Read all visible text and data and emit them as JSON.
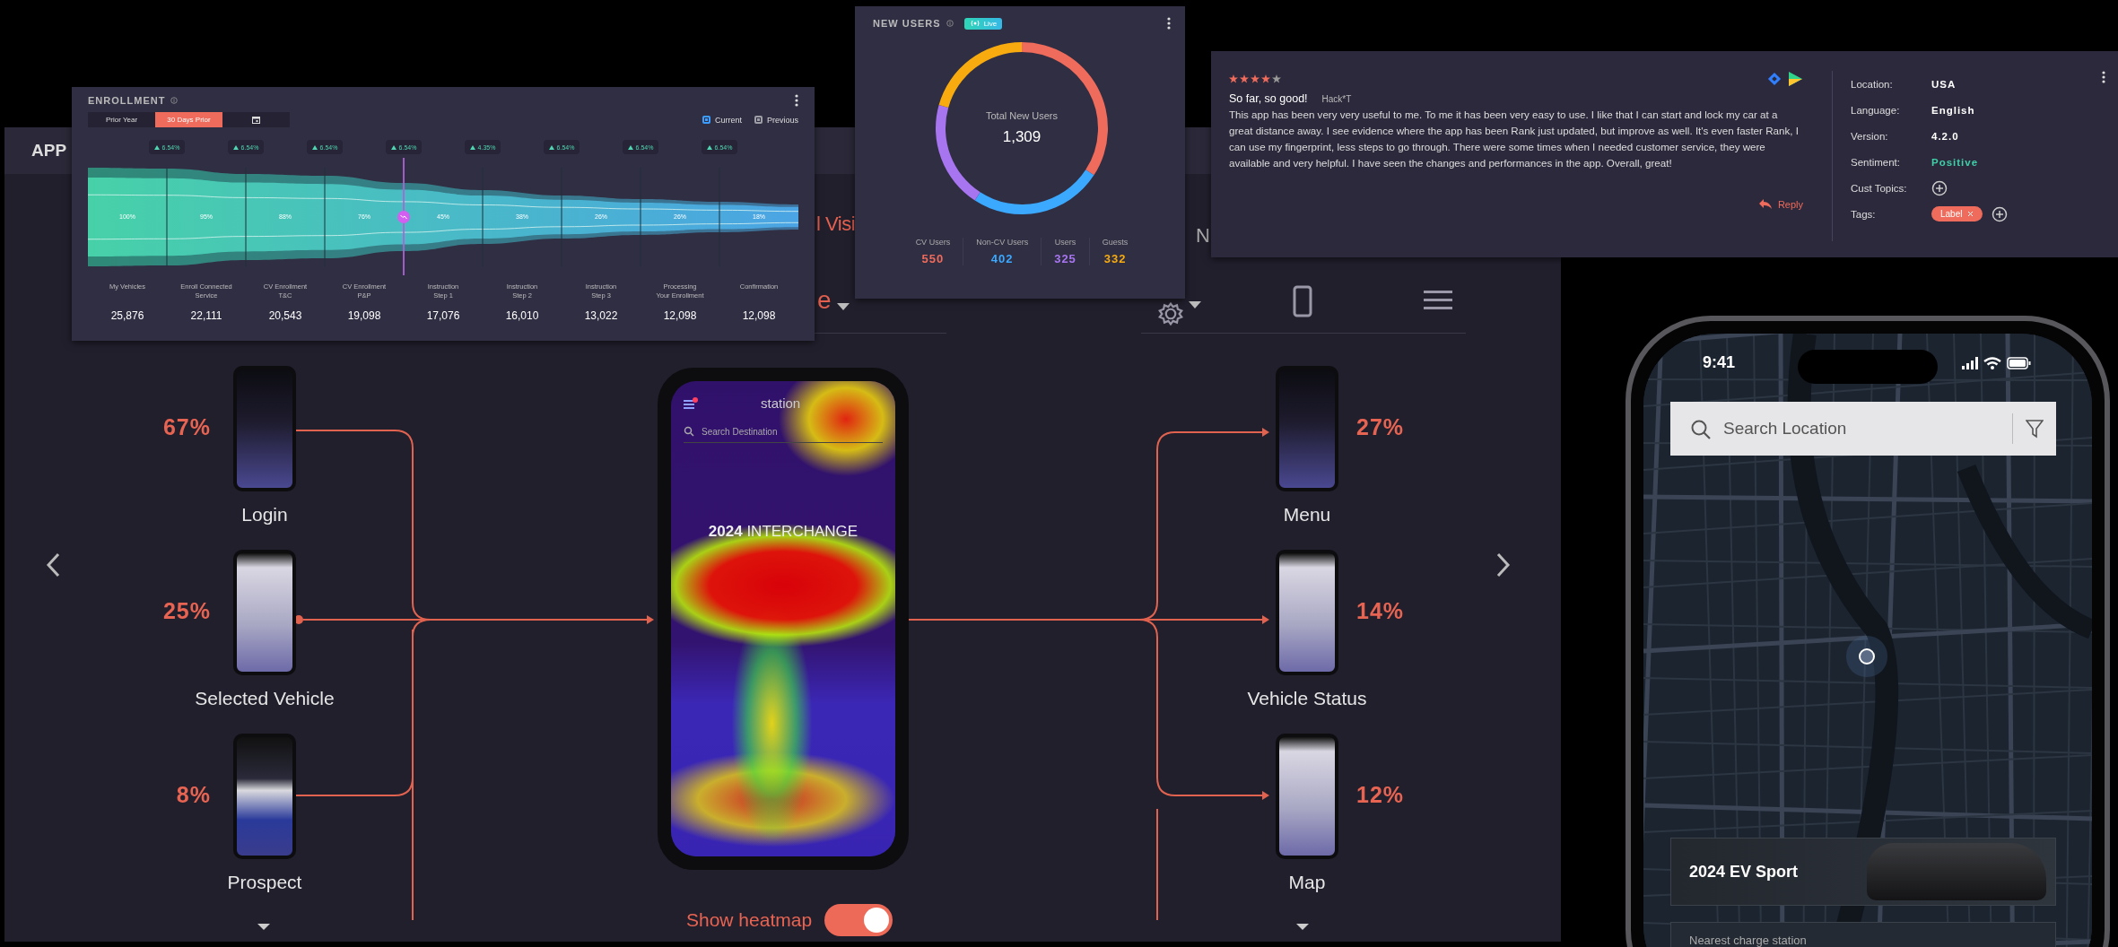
{
  "app_panel": {
    "title": "APP",
    "heading_fragment": "l Visi",
    "dropdown_fragment": "e",
    "side_fragment": "N"
  },
  "flow": {
    "sources": [
      {
        "percent": "67%",
        "label": "Login"
      },
      {
        "percent": "25%",
        "label": "Selected Vehicle"
      },
      {
        "percent": "8%",
        "label": "Prospect"
      }
    ],
    "targets": [
      {
        "percent": "27%",
        "label": "Menu"
      },
      {
        "percent": "14%",
        "label": "Vehicle Status"
      },
      {
        "percent": "12%",
        "label": "Map"
      }
    ]
  },
  "heatmap_phone": {
    "app_name": "station",
    "search_placeholder": "Search Destination",
    "headline": "**2024** INTERCHANGE"
  },
  "show_heatmap": {
    "label": "Show heatmap",
    "on": true
  },
  "enrollment": {
    "title": "ENROLLMENT",
    "periods": [
      {
        "label": "Prior Year",
        "selected": false
      },
      {
        "label": "30 Days Prior",
        "selected": true
      }
    ],
    "legend": [
      {
        "label": "Current",
        "checked": true,
        "color": "#3b9dff"
      },
      {
        "label": "Previous",
        "checked": true,
        "color": "#9e9ea6"
      }
    ],
    "changes": [
      "6.54%",
      "6.54%",
      "6.54%",
      "6.54%",
      "4.35%",
      "6.54%",
      "6.54%",
      "6.54%"
    ],
    "stages": [
      {
        "percent": "100%",
        "name": "My Vehicles",
        "count": "25,876"
      },
      {
        "percent": "95%",
        "name": "Enroll Connected\nService",
        "count": "22,111"
      },
      {
        "percent": "88%",
        "name": "CV Enrollment\nT&C",
        "count": "20,543"
      },
      {
        "percent": "76%",
        "name": "CV Enrollment\nP&P",
        "count": "19,098"
      },
      {
        "percent": "45%",
        "name": "Instruction\nStep 1",
        "count": "17,076"
      },
      {
        "percent": "38%",
        "name": "Instruction\nStep 2",
        "count": "16,010"
      },
      {
        "percent": "26%",
        "name": "Instruction\nStep 3",
        "count": "13,022"
      },
      {
        "percent": "26%",
        "name": "Processing\nYour Enrollment",
        "count": "12,098"
      },
      {
        "percent": "18%",
        "name": "Confirmation",
        "count": "12,098"
      }
    ]
  },
  "new_users": {
    "title": "NEW USERS",
    "badge": "Live",
    "center_label": "Total New Users",
    "total": "1,309",
    "legend": [
      {
        "label": "CV Users",
        "value": "550",
        "color": "#ef6b5b"
      },
      {
        "label": "Non-CV Users",
        "value": "402",
        "color": "#3ba9ff"
      },
      {
        "label": "Users",
        "value": "325",
        "color": "#a875f0"
      },
      {
        "label": "Guests",
        "value": "332",
        "color": "#f7ab0f"
      }
    ]
  },
  "review": {
    "stars": 4,
    "title": "So far, so good!",
    "author": "Hack*T",
    "body": "This app has been very very useful to me. To me it has been very easy to use. I like that I can start and lock my car at a great distance away. I see evidence where the app has been Rank just updated, but improve as well. It's even faster Rank, I can use my fingerprint, less steps to go through. There were some times when I needed customer service, they were available and very helpful. I have seen the changes and performances in the app. Overall, great!",
    "reply": "Reply",
    "details": [
      {
        "kind": "text",
        "label": "Location:",
        "value": "USA"
      },
      {
        "kind": "text",
        "label": "Language:",
        "value": "English"
      },
      {
        "kind": "text",
        "label": "Version:",
        "value": "4.2.0"
      },
      {
        "kind": "sentiment",
        "label": "Sentiment:",
        "value": "Positive"
      },
      {
        "kind": "add",
        "label": "Cust Topics:"
      },
      {
        "kind": "tags",
        "label": "Tags:",
        "tags": [
          "Label"
        ]
      }
    ]
  },
  "mobile": {
    "time": "9:41",
    "search_placeholder": "Search Location",
    "vehicle": "2024 EV Sport",
    "next_card": "Nearest charge station"
  }
}
